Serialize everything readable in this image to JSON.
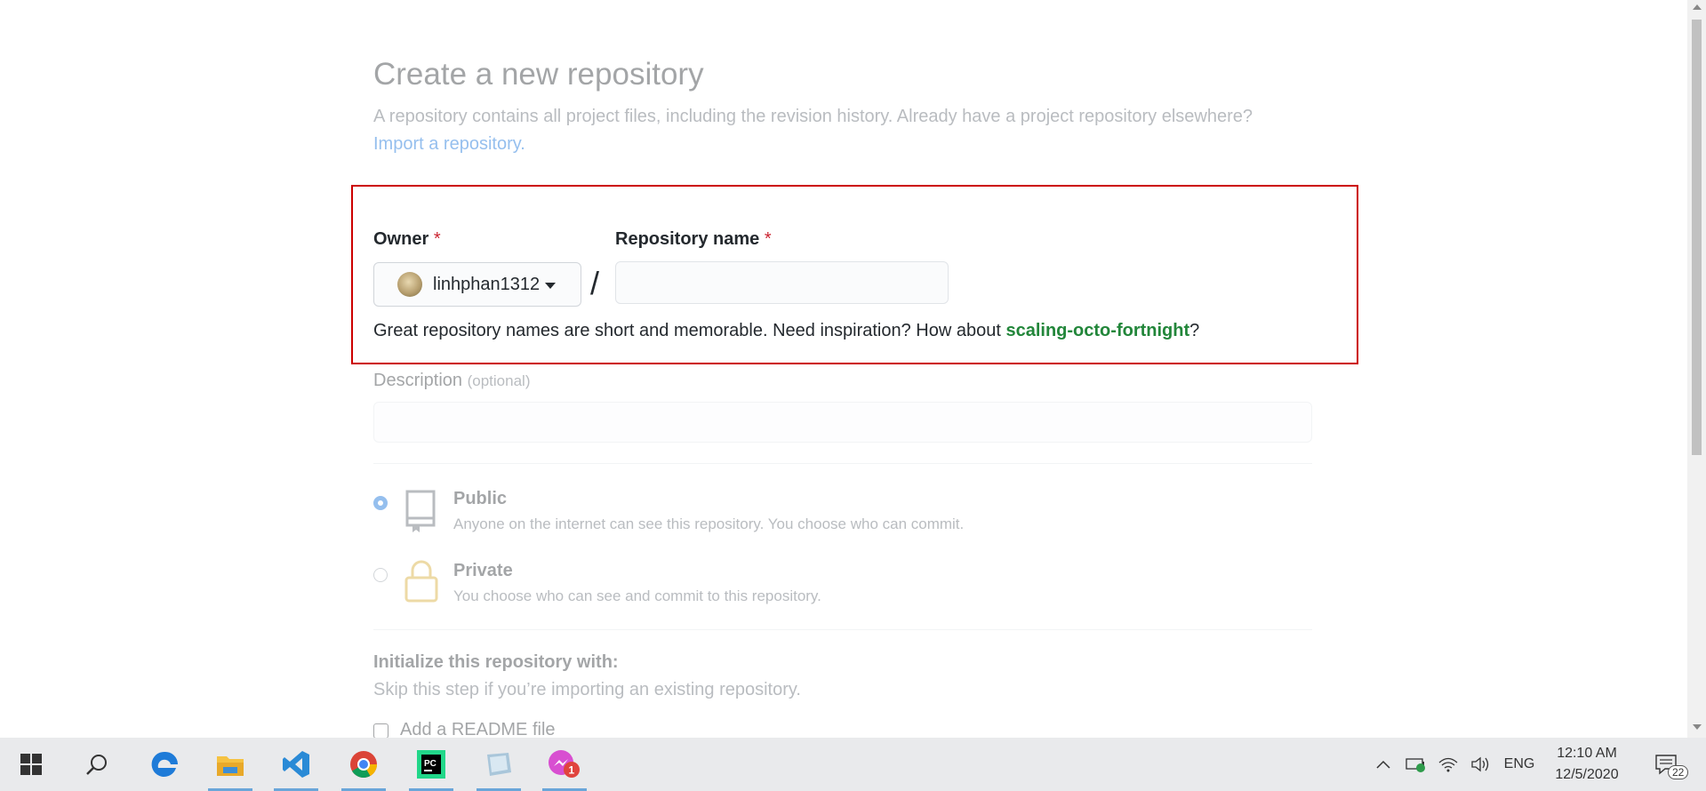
{
  "form": {
    "title": "Create a new repository",
    "subtitle": "A repository contains all project files, including the revision history. Already have a project repository elsewhere?",
    "import_link": "Import a repository.",
    "owner_label": "Owner",
    "required_mark": "*",
    "owner_value": "linhphan1312",
    "separator": "/",
    "repo_name_label": "Repository name",
    "repo_name_value": "",
    "hint_text": "Great repository names are short and memorable. Need inspiration? How about",
    "suggestion": "scaling-octo-fortnight",
    "hint_end": "?",
    "description_label": "Description",
    "description_optional": "(optional)",
    "description_value": "",
    "visibility": [
      {
        "title": "Public",
        "desc": "Anyone on the internet can see this repository. You choose who can commit.",
        "selected": true
      },
      {
        "title": "Private",
        "desc": "You choose who can see and commit to this repository.",
        "selected": false
      }
    ],
    "init_title": "Initialize this repository with:",
    "init_desc": "Skip this step if you’re importing an existing repository.",
    "readme_label": "Add a README file"
  },
  "taskbar": {
    "apps": [
      "start-icon",
      "search-icon",
      "edge-icon",
      "file-explorer-icon",
      "vscode-icon",
      "chrome-icon",
      "pycharm-icon",
      "app-icon",
      "messenger-icon"
    ],
    "messenger_badge": "1",
    "language": "ENG",
    "time": "12:10 AM",
    "date": "12/5/2020",
    "notification_count": "22"
  },
  "colors": {
    "link": "#0366d6",
    "suggestion": "#22863a",
    "required": "#cb2431",
    "highlight_border": "#cc0000"
  }
}
